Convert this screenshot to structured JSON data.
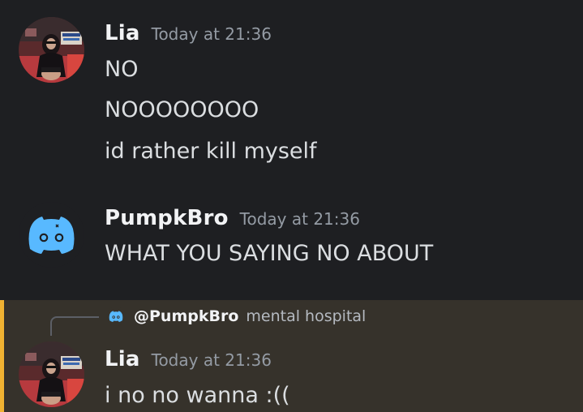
{
  "messages": [
    {
      "author": "Lia",
      "timestamp": "Today at 21:36",
      "lines": [
        "NO",
        "NOOOOOOOO",
        "id rather kill myself"
      ]
    },
    {
      "author": "PumpkBro",
      "timestamp": "Today at 21:36",
      "lines": [
        "WHAT YOU SAYING NO ABOUT"
      ]
    },
    {
      "reply_to": {
        "mention": "@PumpkBro",
        "preview": "mental hospital"
      },
      "author": "Lia",
      "timestamp": "Today at 21:36",
      "lines": [
        "i no no wanna :(("
      ]
    }
  ],
  "colors": {
    "background": "#1e1f22",
    "mention_highlight": "#36322b",
    "mention_bar": "#f0b232",
    "discord_blurple": "#5865f2",
    "discord_avatar_blue": "#58b9ff"
  },
  "icons": {
    "default_avatar": "discord-logo-icon",
    "user_avatar": "photo-avatar"
  }
}
